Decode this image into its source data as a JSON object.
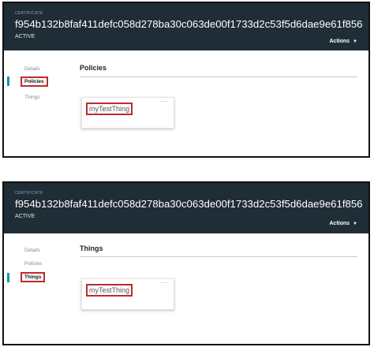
{
  "screens": [
    {
      "header": {
        "label": "CERTIFICATE",
        "id": "f954b132b8faf411defc058d278ba30c063de00f1733d2c53f5d6dae9e61f856",
        "status": "ACTIVE",
        "actions": "Actions",
        "actions_icon": "caret-down-icon"
      },
      "nav": [
        "Details",
        "Policies",
        "Things"
      ],
      "active_nav": "Policies",
      "section_title": "Policies",
      "card": {
        "name": "myTestThing",
        "menu": "···"
      }
    },
    {
      "header": {
        "label": "CERTIFICATE",
        "id": "f954b132b8faf411defc058d278ba30c063de00f1733d2c53f5d6dae9e61f856",
        "status": "ACTIVE",
        "actions": "Actions",
        "actions_icon": "caret-down-icon"
      },
      "nav": [
        "Details",
        "Policies",
        "Things"
      ],
      "active_nav": "Things",
      "section_title": "Things",
      "card": {
        "name": "myTestThing",
        "menu": "···"
      }
    }
  ],
  "colors": {
    "header_bg": "#1f2d37",
    "accent": "#0b9aa6",
    "highlight_border": "#c0292b"
  }
}
